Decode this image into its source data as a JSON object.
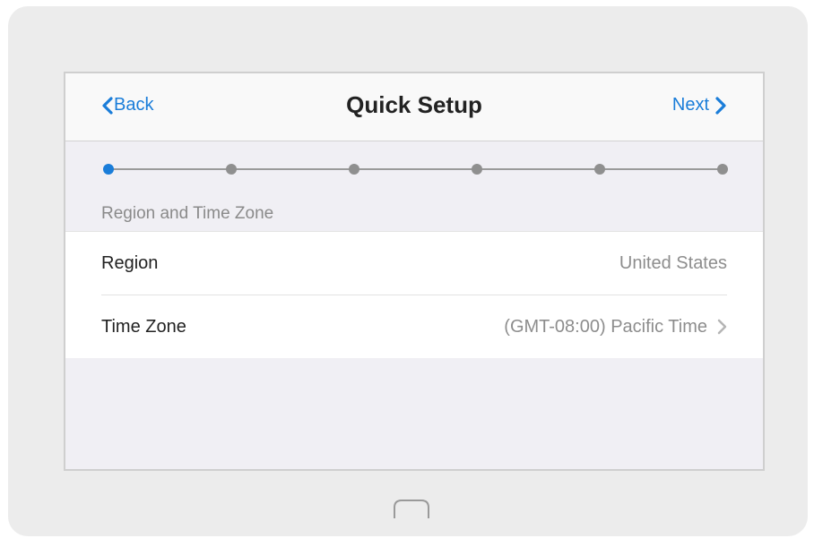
{
  "navbar": {
    "back_label": "Back",
    "title": "Quick Setup",
    "next_label": "Next"
  },
  "progress": {
    "total_steps": 6,
    "current_step": 1
  },
  "section": {
    "label": "Region and Time Zone"
  },
  "settings": [
    {
      "label": "Region",
      "value": "United States"
    },
    {
      "label": "Time Zone",
      "value": "(GMT-08:00) Pacific Time"
    }
  ],
  "colors": {
    "accent": "#1a7dd9",
    "inactive_dot": "#8f8f8f"
  },
  "icons": {
    "back": "chevron-left-icon",
    "next": "chevron-right-icon",
    "disclosure": "chevron-right-icon",
    "home": "home-button-icon"
  }
}
